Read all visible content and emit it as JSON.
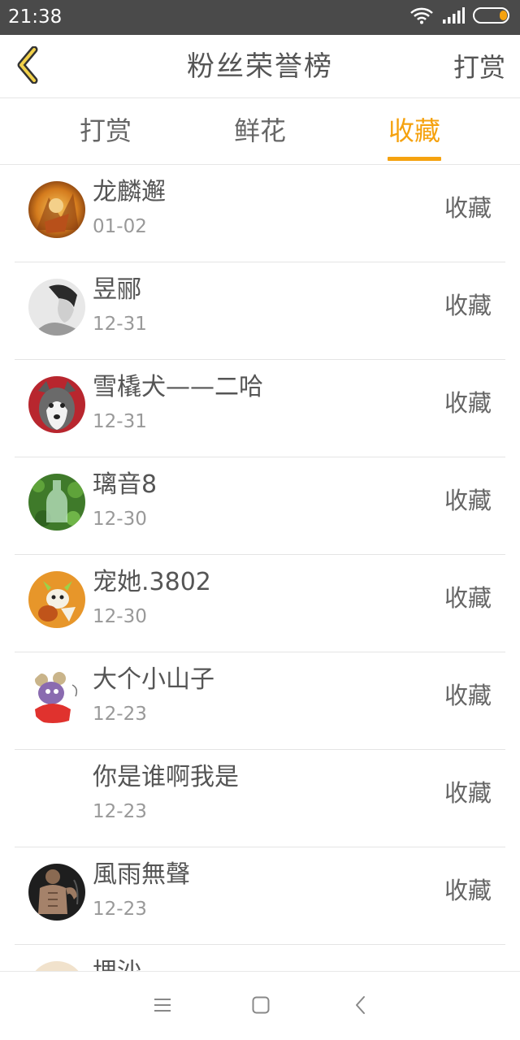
{
  "status_bar": {
    "time": "21:38",
    "icons": [
      "wifi-icon",
      "signal-icon",
      "battery-icon"
    ],
    "battery_color": "#f5a20f"
  },
  "header": {
    "back_icon": "chevron-left-icon",
    "title": "粉丝荣誉榜",
    "reward_label": "打赏"
  },
  "tabs": [
    {
      "label": "打赏",
      "active": false
    },
    {
      "label": "鲜花",
      "active": false
    },
    {
      "label": "收藏",
      "active": true
    }
  ],
  "accent_color": "#f5a20f",
  "list": [
    {
      "name": "龙麟邂",
      "date": "01-02",
      "action": "收藏",
      "avatar": "anime-warrior-avatar"
    },
    {
      "name": "昱郦",
      "date": "12-31",
      "action": "收藏",
      "avatar": "man-portrait-avatar"
    },
    {
      "name": "雪橇犬——二哈",
      "date": "12-31",
      "action": "收藏",
      "avatar": "husky-dog-avatar"
    },
    {
      "name": "璃音8",
      "date": "12-30",
      "action": "收藏",
      "avatar": "glass-bottle-grass-avatar"
    },
    {
      "name": "宠她.3802",
      "date": "12-30",
      "action": "收藏",
      "avatar": "cartoon-dragon-avatar"
    },
    {
      "name": "大个小山子",
      "date": "12-23",
      "action": "收藏",
      "avatar": "cartoon-mouse-avatar"
    },
    {
      "name": "你是谁啊我是",
      "date": "12-23",
      "action": "收藏",
      "avatar": ""
    },
    {
      "name": "風雨無聲",
      "date": "12-23",
      "action": "收藏",
      "avatar": "muscular-man-avatar"
    },
    {
      "name": "埋沙",
      "date": "",
      "action": "",
      "avatar": "partial-avatar"
    }
  ],
  "bottom_nav": [
    "menu-icon",
    "home-icon",
    "back-icon"
  ]
}
